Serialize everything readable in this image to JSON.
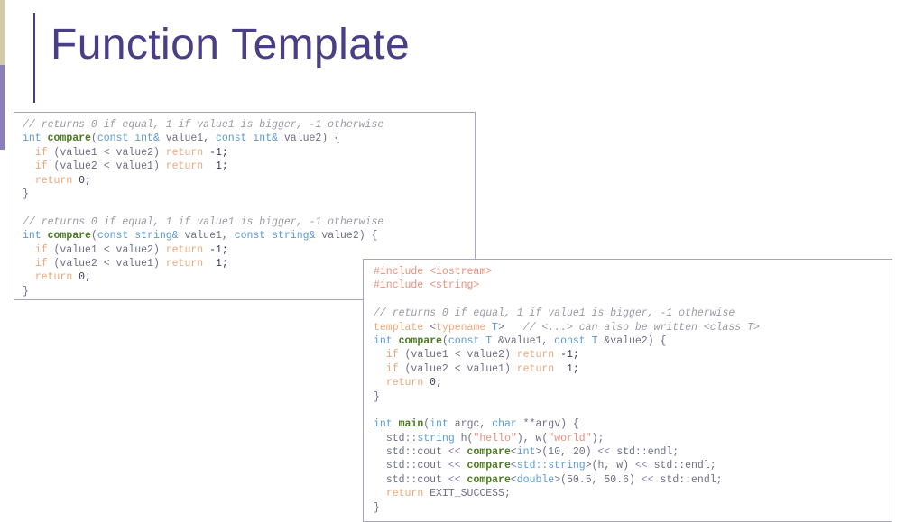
{
  "slide": {
    "title": "Function Template",
    "theme": {
      "title_color": "#4a3f86",
      "edge_top_color": "#cfcba6",
      "edge_bottom_color": "#8c7fb8",
      "box_border_color": "#a9a6bd",
      "background": "#ffffff"
    }
  },
  "code_box_1": {
    "language": "cpp",
    "lines": [
      [
        {
          "t": "comment",
          "s": "// returns 0 if equal, 1 if value1 is bigger, -1 otherwise"
        }
      ],
      [
        {
          "t": "type",
          "s": "int"
        },
        {
          "t": "plain",
          "s": " "
        },
        {
          "t": "fn",
          "s": "compare"
        },
        {
          "t": "plain",
          "s": "("
        },
        {
          "t": "type",
          "s": "const int&"
        },
        {
          "t": "plain",
          "s": " value1, "
        },
        {
          "t": "type",
          "s": "const int&"
        },
        {
          "t": "plain",
          "s": " value2) {"
        }
      ],
      [
        {
          "t": "plain",
          "s": "  "
        },
        {
          "t": "keyword",
          "s": "if"
        },
        {
          "t": "plain",
          "s": " (value1 < value2) "
        },
        {
          "t": "keyword",
          "s": "return"
        },
        {
          "t": "num",
          "s": " -1;"
        }
      ],
      [
        {
          "t": "plain",
          "s": "  "
        },
        {
          "t": "keyword",
          "s": "if"
        },
        {
          "t": "plain",
          "s": " (value2 < value1) "
        },
        {
          "t": "keyword",
          "s": "return"
        },
        {
          "t": "num",
          "s": "  1;"
        }
      ],
      [
        {
          "t": "plain",
          "s": "  "
        },
        {
          "t": "keyword",
          "s": "return"
        },
        {
          "t": "num",
          "s": " 0;"
        }
      ],
      [
        {
          "t": "plain",
          "s": "}"
        }
      ],
      [
        {
          "t": "plain",
          "s": ""
        }
      ],
      [
        {
          "t": "comment",
          "s": "// returns 0 if equal, 1 if value1 is bigger, -1 otherwise"
        }
      ],
      [
        {
          "t": "type",
          "s": "int"
        },
        {
          "t": "plain",
          "s": " "
        },
        {
          "t": "fn",
          "s": "compare"
        },
        {
          "t": "plain",
          "s": "("
        },
        {
          "t": "type",
          "s": "const string&"
        },
        {
          "t": "plain",
          "s": " value1, "
        },
        {
          "t": "type",
          "s": "const string&"
        },
        {
          "t": "plain",
          "s": " value2) {"
        }
      ],
      [
        {
          "t": "plain",
          "s": "  "
        },
        {
          "t": "keyword",
          "s": "if"
        },
        {
          "t": "plain",
          "s": " (value1 < value2) "
        },
        {
          "t": "keyword",
          "s": "return"
        },
        {
          "t": "num",
          "s": " -1;"
        }
      ],
      [
        {
          "t": "plain",
          "s": "  "
        },
        {
          "t": "keyword",
          "s": "if"
        },
        {
          "t": "plain",
          "s": " (value2 < value1) "
        },
        {
          "t": "keyword",
          "s": "return"
        },
        {
          "t": "num",
          "s": "  1;"
        }
      ],
      [
        {
          "t": "plain",
          "s": "  "
        },
        {
          "t": "keyword",
          "s": "return"
        },
        {
          "t": "num",
          "s": " 0;"
        }
      ],
      [
        {
          "t": "plain",
          "s": "}"
        }
      ]
    ]
  },
  "code_box_2": {
    "language": "cpp",
    "lines": [
      [
        {
          "t": "pre",
          "s": "#include <iostream>"
        }
      ],
      [
        {
          "t": "pre",
          "s": "#include <string>"
        }
      ],
      [
        {
          "t": "plain",
          "s": ""
        }
      ],
      [
        {
          "t": "comment",
          "s": "// returns 0 if equal, 1 if value1 is bigger, -1 otherwise"
        }
      ],
      [
        {
          "t": "keyword",
          "s": "template"
        },
        {
          "t": "plain",
          "s": " <"
        },
        {
          "t": "keyword",
          "s": "typename"
        },
        {
          "t": "plain",
          "s": " "
        },
        {
          "t": "type",
          "s": "T"
        },
        {
          "t": "plain",
          "s": ">   "
        },
        {
          "t": "comment",
          "s": "// <...> can also be written <class T>"
        }
      ],
      [
        {
          "t": "type",
          "s": "int"
        },
        {
          "t": "plain",
          "s": " "
        },
        {
          "t": "fn",
          "s": "compare"
        },
        {
          "t": "plain",
          "s": "("
        },
        {
          "t": "type",
          "s": "const T"
        },
        {
          "t": "plain",
          "s": " &value1, "
        },
        {
          "t": "type",
          "s": "const T"
        },
        {
          "t": "plain",
          "s": " &value2) {"
        }
      ],
      [
        {
          "t": "plain",
          "s": "  "
        },
        {
          "t": "keyword",
          "s": "if"
        },
        {
          "t": "plain",
          "s": " (value1 < value2) "
        },
        {
          "t": "keyword",
          "s": "return"
        },
        {
          "t": "num",
          "s": " -1;"
        }
      ],
      [
        {
          "t": "plain",
          "s": "  "
        },
        {
          "t": "keyword",
          "s": "if"
        },
        {
          "t": "plain",
          "s": " (value2 < value1) "
        },
        {
          "t": "keyword",
          "s": "return"
        },
        {
          "t": "num",
          "s": "  1;"
        }
      ],
      [
        {
          "t": "plain",
          "s": "  "
        },
        {
          "t": "keyword",
          "s": "return"
        },
        {
          "t": "num",
          "s": " 0;"
        }
      ],
      [
        {
          "t": "plain",
          "s": "}"
        }
      ],
      [
        {
          "t": "plain",
          "s": ""
        }
      ],
      [
        {
          "t": "type",
          "s": "int"
        },
        {
          "t": "plain",
          "s": " "
        },
        {
          "t": "fn",
          "s": "main"
        },
        {
          "t": "plain",
          "s": "("
        },
        {
          "t": "type",
          "s": "int"
        },
        {
          "t": "plain",
          "s": " argc, "
        },
        {
          "t": "type",
          "s": "char"
        },
        {
          "t": "plain",
          "s": " **argv) {"
        }
      ],
      [
        {
          "t": "plain",
          "s": "  "
        },
        {
          "t": "ns",
          "s": "std::"
        },
        {
          "t": "type",
          "s": "string"
        },
        {
          "t": "plain",
          "s": " h("
        },
        {
          "t": "str",
          "s": "\"hello\""
        },
        {
          "t": "plain",
          "s": "), w("
        },
        {
          "t": "str",
          "s": "\"world\""
        },
        {
          "t": "plain",
          "s": ");"
        }
      ],
      [
        {
          "t": "plain",
          "s": "  "
        },
        {
          "t": "ns",
          "s": "std::cout"
        },
        {
          "t": "op",
          "s": " << "
        },
        {
          "t": "fn",
          "s": "compare"
        },
        {
          "t": "plain",
          "s": "<"
        },
        {
          "t": "type",
          "s": "int"
        },
        {
          "t": "plain",
          "s": ">(10, 20)"
        },
        {
          "t": "op",
          "s": " << "
        },
        {
          "t": "ns",
          "s": "std::endl;"
        }
      ],
      [
        {
          "t": "plain",
          "s": "  "
        },
        {
          "t": "ns",
          "s": "std::cout"
        },
        {
          "t": "op",
          "s": " << "
        },
        {
          "t": "fn",
          "s": "compare"
        },
        {
          "t": "plain",
          "s": "<"
        },
        {
          "t": "type",
          "s": "std::string"
        },
        {
          "t": "plain",
          "s": ">(h, w)"
        },
        {
          "t": "op",
          "s": " << "
        },
        {
          "t": "ns",
          "s": "std::endl;"
        }
      ],
      [
        {
          "t": "plain",
          "s": "  "
        },
        {
          "t": "ns",
          "s": "std::cout"
        },
        {
          "t": "op",
          "s": " << "
        },
        {
          "t": "fn",
          "s": "compare"
        },
        {
          "t": "plain",
          "s": "<"
        },
        {
          "t": "type",
          "s": "double"
        },
        {
          "t": "plain",
          "s": ">(50.5, 50.6)"
        },
        {
          "t": "op",
          "s": " << "
        },
        {
          "t": "ns",
          "s": "std::endl;"
        }
      ],
      [
        {
          "t": "plain",
          "s": "  "
        },
        {
          "t": "keyword",
          "s": "return"
        },
        {
          "t": "plain",
          "s": " EXIT_SUCCESS;"
        }
      ],
      [
        {
          "t": "plain",
          "s": "}"
        }
      ]
    ]
  }
}
